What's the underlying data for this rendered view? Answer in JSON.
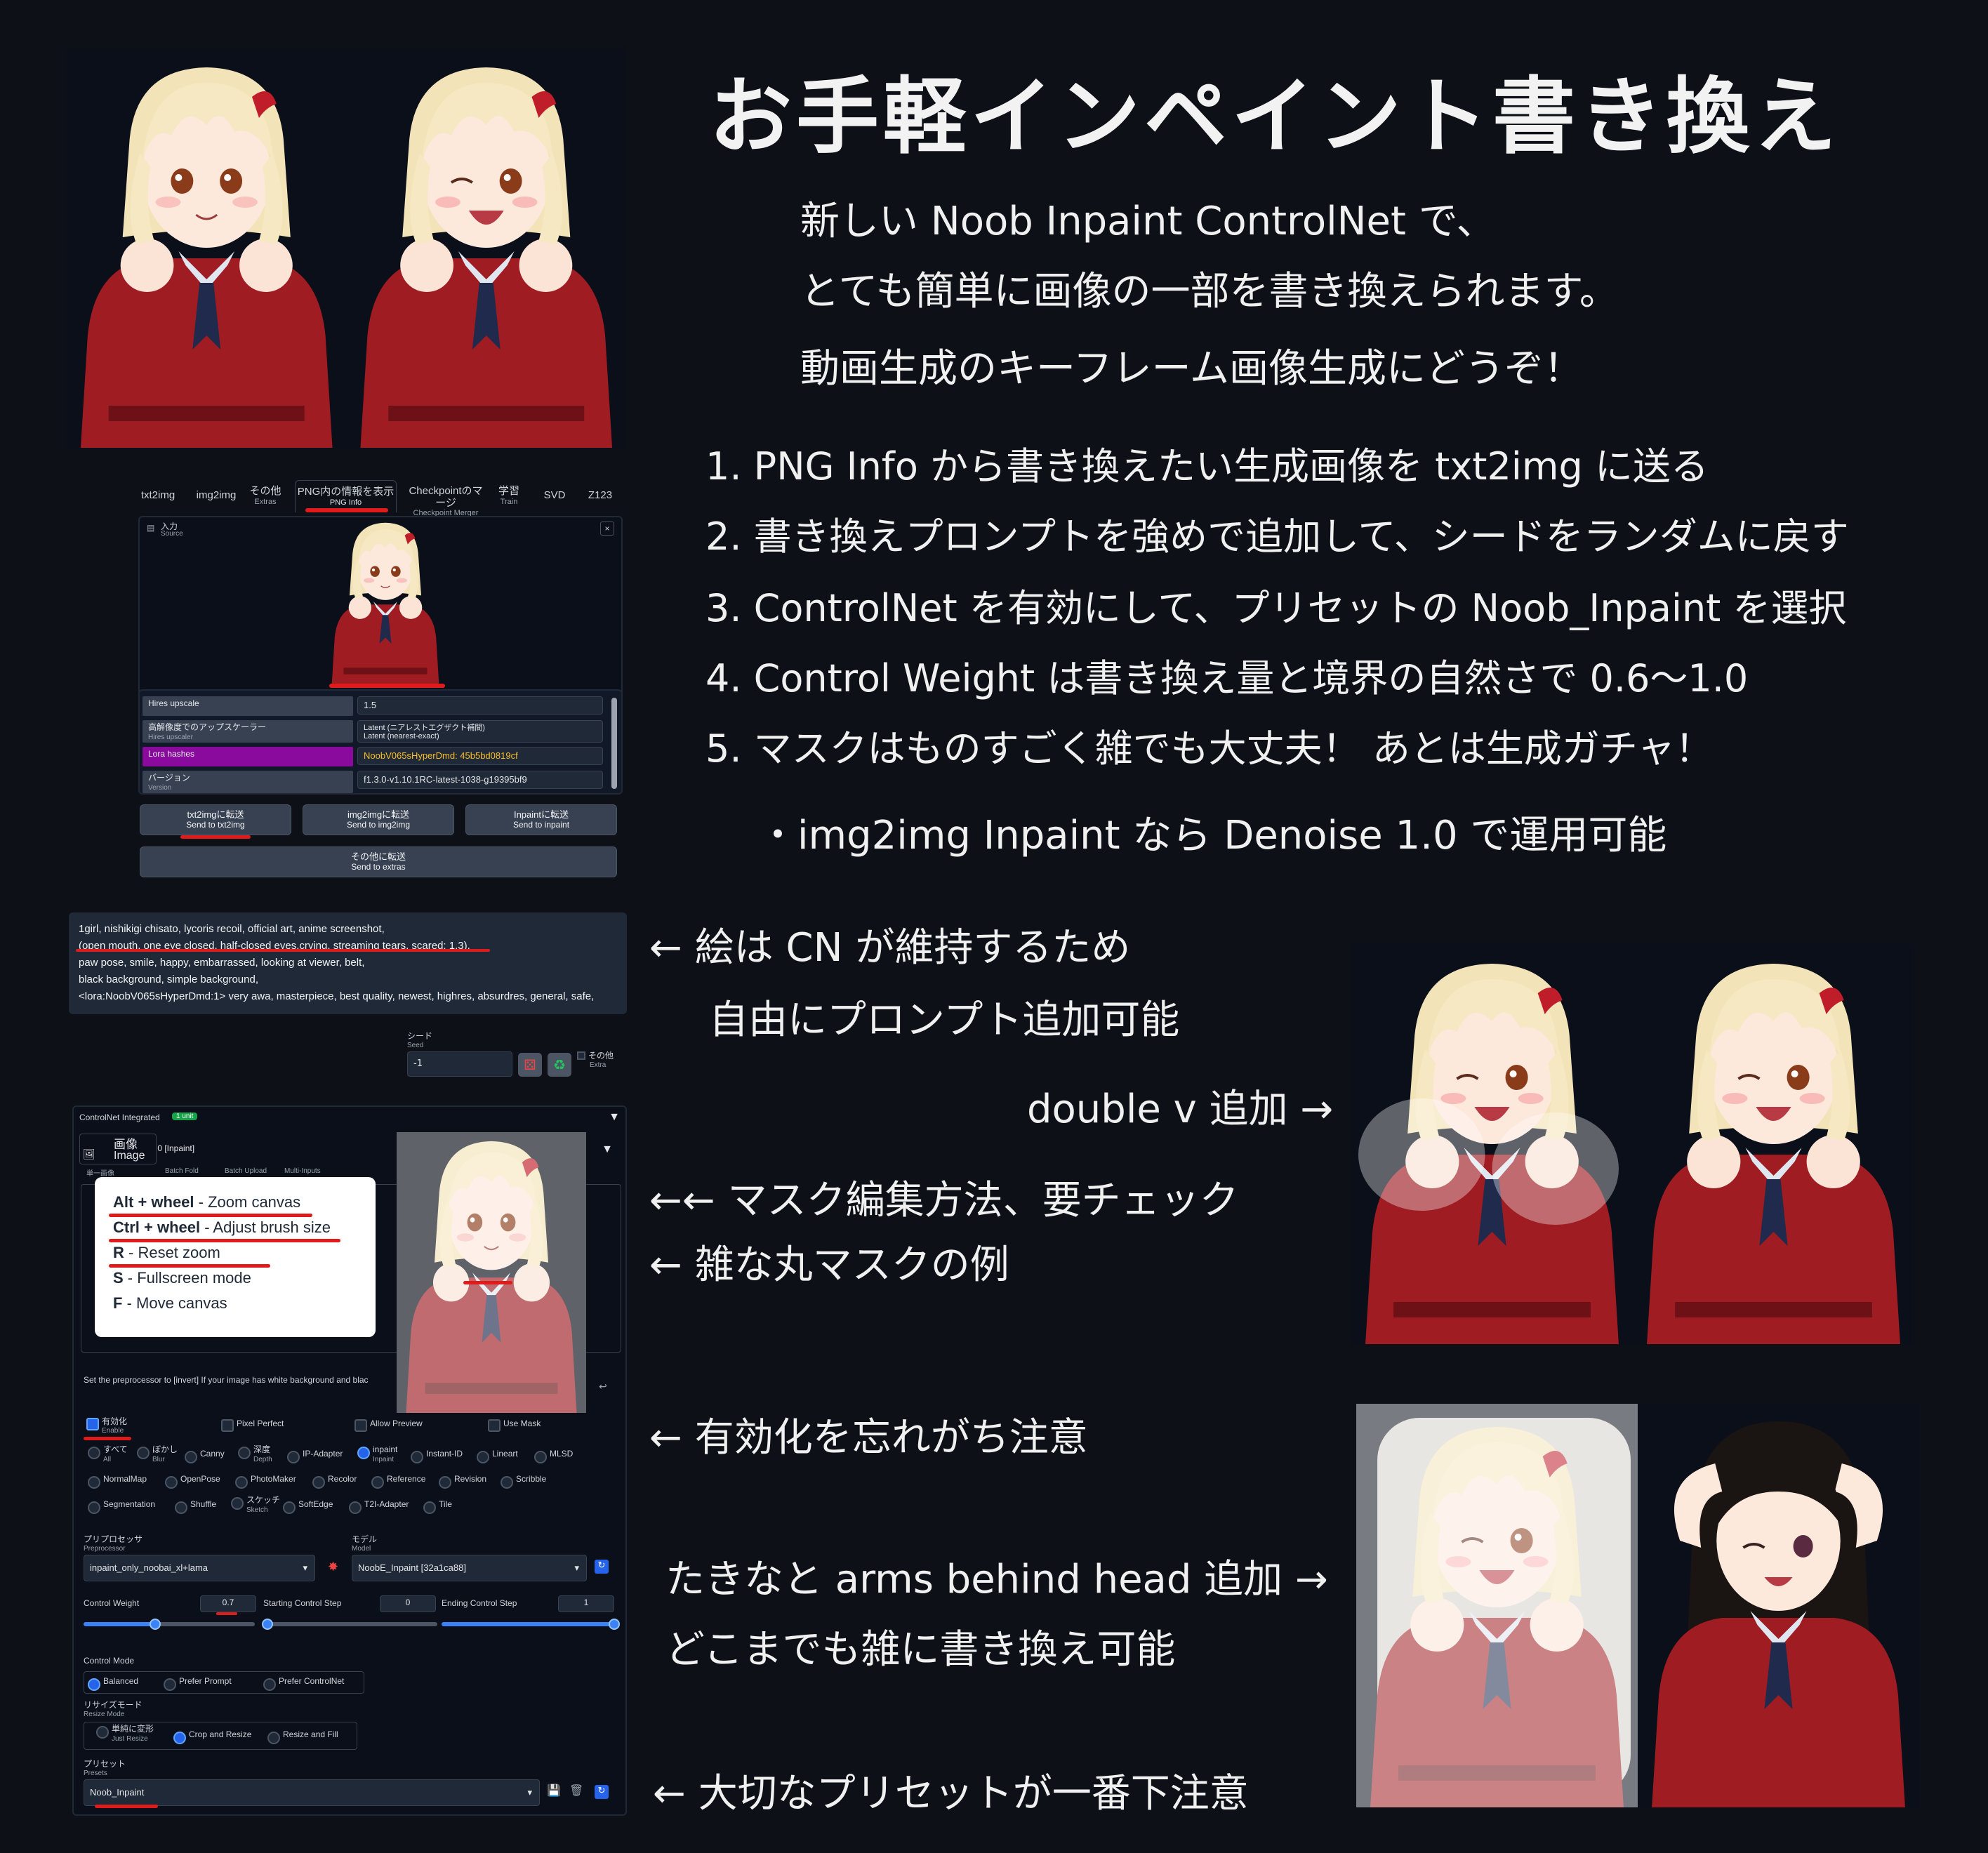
{
  "title": "お手軽インペイント書き換え",
  "intro": {
    "line1": "新しい Noob Inpaint ControlNet で、",
    "line2": "とても簡単に画像の一部を書き換えられます。",
    "line3": "動画生成のキーフレーム画像生成にどうぞ！"
  },
  "steps": [
    "1. PNG Info から書き換えたい生成画像を txt2img に送る",
    "2. 書き換えプロンプトを強めで追加して、シードをランダムに戻す",
    "3. ControlNet を有効にして、プリセットの Noob_Inpaint を選択",
    "4. Control Weight は書き換え量と境界の自然さで 0.6〜1.0",
    "5. マスクはものすごく雑でも大丈夫！ あとは生成ガチャ！"
  ],
  "bullet_note": "・img2img Inpaint なら Denoise 1.0 で運用可能",
  "annotations": {
    "cn_keep_1": "← 絵は CN が維持するため",
    "cn_keep_2": "自由にプロンプト追加可能",
    "double_v": "double v 追加 →",
    "mask_edit": "←← マスク編集方法、要チェック",
    "rough_mask": "← 雑な丸マスクの例",
    "enable_note": "← 有効化を忘れがち注意",
    "takina_1": "たきなと arms behind head 追加 →",
    "takina_2": "どこまでも雑に書き換え可能",
    "preset_note": "← 大切なプリセットが一番下注意"
  },
  "png_info_panel": {
    "tabs": [
      {
        "label": "txt2img",
        "sub": ""
      },
      {
        "label": "img2img",
        "sub": ""
      },
      {
        "label": "その他",
        "sub": "Extras"
      },
      {
        "label": "PNG内の情報を表示",
        "sub": "PNG Info"
      },
      {
        "label": "Checkpointのマージ",
        "sub": "Checkpoint Merger"
      },
      {
        "label": "学習",
        "sub": "Train"
      },
      {
        "label": "SVD",
        "sub": ""
      },
      {
        "label": "Z123",
        "sub": ""
      }
    ],
    "source_label": "入力",
    "source_sub": "Source",
    "close_icon_text": "×",
    "rows": [
      {
        "label": "Hires upscale",
        "sub": "",
        "value": "1.5"
      },
      {
        "label": "高解像度でのアップスケーラー",
        "sub": "Hires upscaler",
        "value": "Latent (ニアレストエグザクト補間)",
        "value_sub": "Latent (nearest-exact)"
      },
      {
        "label": "Lora hashes",
        "sub": "",
        "value": "NoobV065sHyperDmd: 45b5bd0819cf"
      },
      {
        "label": "バージョン",
        "sub": "Version",
        "value": "f1.3.0-v1.10.1RC-latest-1038-g19395bf9"
      }
    ],
    "buttons": [
      {
        "label": "txt2imgに転送",
        "sub": "Send to txt2img"
      },
      {
        "label": "img2imgに転送",
        "sub": "Send to img2img"
      },
      {
        "label": "Inpaintに転送",
        "sub": "Send to inpaint"
      },
      {
        "label": "その他に転送",
        "sub": "Send to extras"
      }
    ]
  },
  "prompt": {
    "line1": "1girl, nishikigi chisato, lycoris recoil, official art, anime screenshot,",
    "line2": "(open mouth, one eye closed, half-closed eyes,crying, streaming tears, scared: 1.3),",
    "line3": "paw pose, smile, happy, embarrassed, looking at viewer,  belt,",
    "line4": "black background, simple background,",
    "line5": "<lora:NoobV065sHyperDmd:1> very awa, masterpiece, best quality, newest, highres, absurdres, general, safe,"
  },
  "seed": {
    "label": "シード",
    "sub": "Seed",
    "value": "-1",
    "extra_label": "その他",
    "extra_sub": "Extra",
    "dice_icon": "dice-icon",
    "recycle_icon": "recycle-icon"
  },
  "controlnet": {
    "header": "ControlNet Integrated",
    "badge": "1 unit",
    "unit_tab": "it 0  [Inpaint]",
    "image_label": "画像",
    "image_sub": "Image",
    "single_image_tab": "単一画像",
    "batch_tab": "Batch Fold",
    "batch_upload_tab": "Batch Upload",
    "multi_inputs_tab": "Multi-Inputs",
    "tooltip": [
      {
        "key": "Alt + wheel",
        "desc": " - Zoom canvas"
      },
      {
        "key": "Ctrl + wheel",
        "desc": " - Adjust brush size"
      },
      {
        "key": "R",
        "desc": " - Reset zoom"
      },
      {
        "key": "S",
        "desc": " - Fullscreen mode"
      },
      {
        "key": "F",
        "desc": " - Move canvas"
      }
    ],
    "hint": "Set the preprocessor to [invert] If your image has white background and blac",
    "enable_label": "有効化",
    "enable_sub": "Enable",
    "pixel_perfect": "Pixel Perfect",
    "allow_preview": "Allow Preview",
    "use_mask": "Use Mask",
    "types_row1": [
      {
        "label": "すべて",
        "sub": "All",
        "on": false
      },
      {
        "label": "ぼかし",
        "sub": "Blur",
        "on": false
      },
      {
        "label": "Canny",
        "sub": "",
        "on": false
      },
      {
        "label": "深度",
        "sub": "Depth",
        "on": false
      },
      {
        "label": "IP-Adapter",
        "sub": "",
        "on": false
      },
      {
        "label": "inpaint",
        "sub": "Inpaint",
        "on": true
      },
      {
        "label": "Instant-ID",
        "sub": "",
        "on": false
      },
      {
        "label": "Lineart",
        "sub": "",
        "on": false
      },
      {
        "label": "MLSD",
        "sub": "",
        "on": false
      }
    ],
    "types_row2": [
      {
        "label": "NormalMap",
        "sub": ""
      },
      {
        "label": "OpenPose",
        "sub": ""
      },
      {
        "label": "PhotoMaker",
        "sub": ""
      },
      {
        "label": "Recolor",
        "sub": ""
      },
      {
        "label": "Reference",
        "sub": ""
      },
      {
        "label": "Revision",
        "sub": ""
      },
      {
        "label": "Scribble",
        "sub": ""
      }
    ],
    "types_row3": [
      {
        "label": "Segmentation",
        "sub": ""
      },
      {
        "label": "Shuffle",
        "sub": ""
      },
      {
        "label": "スケッチ",
        "sub": "Sketch"
      },
      {
        "label": "SoftEdge",
        "sub": ""
      },
      {
        "label": "T2I-Adapter",
        "sub": ""
      },
      {
        "label": "Tile",
        "sub": ""
      }
    ],
    "preprocessor_label": "プリプロセッサ",
    "preprocessor_sub": "Preprocessor",
    "preprocessor_value": "inpaint_only_noobai_xl+lama",
    "model_label": "モデル",
    "model_sub": "Model",
    "model_value": "NoobE_Inpaint [32a1ca88]",
    "control_weight_label": "Control Weight",
    "control_weight_value": "0.7",
    "start_step_label": "Starting Control Step",
    "start_step_value": "0",
    "end_step_label": "Ending Control Step",
    "end_step_value": "1",
    "control_mode_label": "Control Mode",
    "control_modes": [
      "Balanced",
      "Prefer Prompt",
      "Prefer ControlNet"
    ],
    "resize_mode_label": "リサイズモード",
    "resize_mode_sub": "Resize Mode",
    "resize_modes": [
      {
        "label": "単純に変形",
        "sub": "Just Resize"
      },
      {
        "label": "Crop and Resize",
        "sub": ""
      },
      {
        "label": "Resize and Fill",
        "sub": ""
      }
    ],
    "presets_label": "プリセット",
    "presets_sub": "Presets",
    "presets_value": "Noob_Inpaint"
  },
  "colors": {
    "background": "#0d1117",
    "highlight_red": "#e01b1b",
    "lora_purple": "#8b0a9e",
    "accent_blue": "#3b82f6"
  }
}
